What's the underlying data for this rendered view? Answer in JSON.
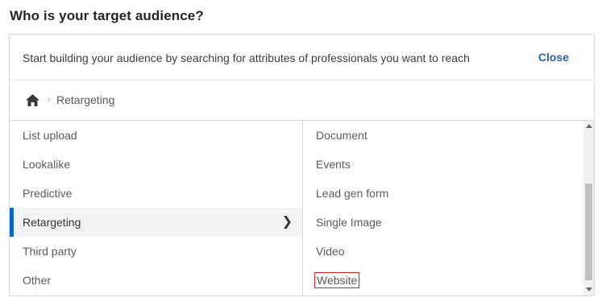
{
  "heading": "Who is your target audience?",
  "search": {
    "hint": "Start building your audience by searching for attributes of professionals you want to reach",
    "close_label": "Close"
  },
  "breadcrumb": {
    "home_icon": "home-icon",
    "separator": "›",
    "current": "Retargeting"
  },
  "categories": [
    {
      "label": "List upload"
    },
    {
      "label": "Lookalike"
    },
    {
      "label": "Predictive"
    },
    {
      "label": "Retargeting",
      "selected": true
    },
    {
      "label": "Third party"
    },
    {
      "label": "Other"
    }
  ],
  "selected_chevron": "❯",
  "subcategories": [
    {
      "label": "Document"
    },
    {
      "label": "Events"
    },
    {
      "label": "Lead gen form"
    },
    {
      "label": "Single Image"
    },
    {
      "label": "Video"
    },
    {
      "label": "Website",
      "highlighted": true
    }
  ],
  "colors": {
    "accent": "#0a66c2",
    "link": "#2862a8",
    "highlight_box": "#e02020"
  }
}
